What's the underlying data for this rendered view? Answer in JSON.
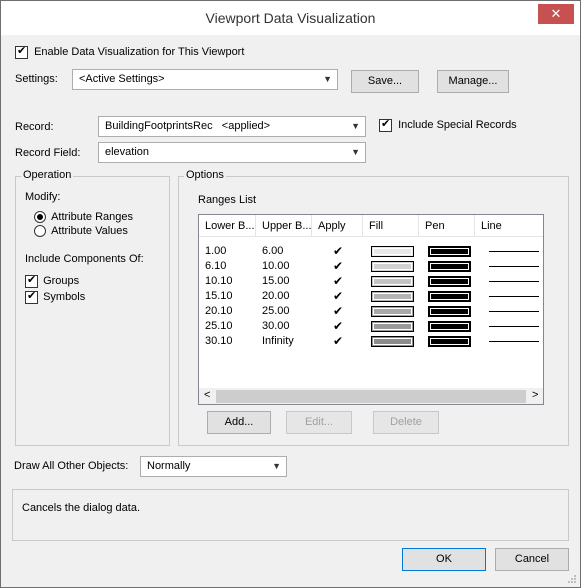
{
  "window": {
    "title": "Viewport Data Visualization",
    "close_glyph": "✕"
  },
  "enable": {
    "label": "Enable Data Visualization for This Viewport",
    "checked": true
  },
  "settings": {
    "label": "Settings:",
    "value": "<Active Settings>",
    "save": "Save...",
    "manage": "Manage..."
  },
  "record": {
    "label": "Record:",
    "value": "BuildingFootprintsRec   <applied>",
    "include_special_label": "Include Special Records",
    "include_special_checked": true
  },
  "record_field": {
    "label": "Record Field:",
    "value": "elevation"
  },
  "operation": {
    "group_label": "Operation",
    "modify_label": "Modify:",
    "radio_ranges": "Attribute Ranges",
    "radio_values": "Attribute Values",
    "include_label": "Include Components Of:",
    "groups": "Groups",
    "symbols": "Symbols"
  },
  "options": {
    "group_label": "Options",
    "ranges_label": "Ranges List",
    "columns": [
      "Lower B...",
      "Upper B...",
      "Apply",
      "Fill",
      "Pen",
      "Line"
    ],
    "rows": [
      {
        "lower": "1.00",
        "upper": "6.00",
        "apply": "✔",
        "fill": "#e8e8e8"
      },
      {
        "lower": "6.10",
        "upper": "10.00",
        "apply": "✔",
        "fill": "#d2d2d2"
      },
      {
        "lower": "10.10",
        "upper": "15.00",
        "apply": "✔",
        "fill": "#c4c4c4"
      },
      {
        "lower": "15.10",
        "upper": "20.00",
        "apply": "✔",
        "fill": "#b4b4b4"
      },
      {
        "lower": "20.10",
        "upper": "25.00",
        "apply": "✔",
        "fill": "#a8a8a8"
      },
      {
        "lower": "25.10",
        "upper": "30.00",
        "apply": "✔",
        "fill": "#9a9a9a"
      },
      {
        "lower": "30.10",
        "upper": "Infinity",
        "apply": "✔",
        "fill": "#8c8c8c"
      }
    ],
    "add": "Add...",
    "edit": "Edit...",
    "delete": "Delete",
    "scroll_left": "<",
    "scroll_right": ">"
  },
  "draw_other": {
    "label": "Draw All Other Objects:",
    "value": "Normally"
  },
  "status": {
    "text": "Cancels the dialog data."
  },
  "buttons": {
    "ok": "OK",
    "cancel": "Cancel"
  }
}
